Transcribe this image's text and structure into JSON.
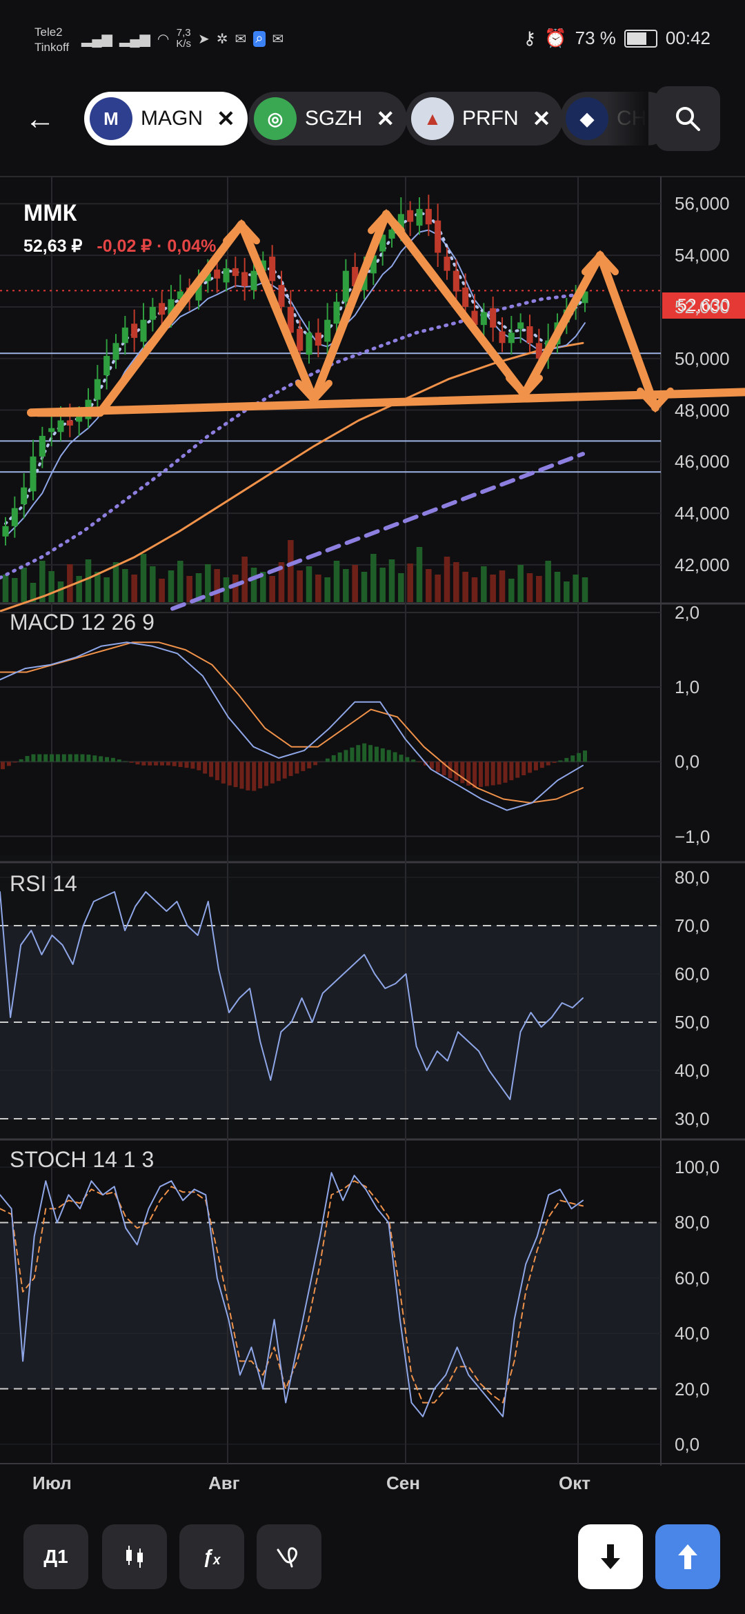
{
  "status": {
    "carrier1": "Tele2",
    "carrier2": "Tinkoff",
    "speed_top": "7,3",
    "speed_bottom": "K/s",
    "battery": "73 %",
    "time": "00:42"
  },
  "header": {
    "tabs": [
      {
        "label": "MAGN",
        "active": true
      },
      {
        "label": "SGZH",
        "active": false
      },
      {
        "label": "PRFN",
        "active": false
      },
      {
        "label": "CH",
        "active": false
      }
    ]
  },
  "instrument": {
    "name": "ММК",
    "price": "52,63 ₽",
    "change": "-0,02 ₽ · 0,04%",
    "last_price_tag": "52,630"
  },
  "panels": {
    "macd": "MACD 12 26 9",
    "rsi": "RSI 14",
    "stoch": "STOCH 14 1 3"
  },
  "toolbar": {
    "interval": "Д1"
  },
  "colors": {
    "bg": "#0f0f11",
    "up": "#2e9e3e",
    "down": "#c03a2b",
    "orange": "#f0924a",
    "blue": "#8fa7e8",
    "purple": "#8c7fe0",
    "accent_blue": "#4a86e8",
    "price_red": "#e53935"
  },
  "chart_data": [
    {
      "type": "candlestick",
      "title": "ММК",
      "x_ticks": [
        "Июл",
        "Авг",
        "Сен",
        "Окт"
      ],
      "y_ticks": [
        "56,000",
        "54,000",
        "52,000",
        "50,000",
        "48,000",
        "46,000",
        "44,000",
        "42,000"
      ],
      "ylim": [
        40.5,
        57
      ],
      "last_price": 52.63,
      "close": [
        43.5,
        44.2,
        45.0,
        46.2,
        47.0,
        47.3,
        47.6,
        47.4,
        47.8,
        48.4,
        49.2,
        50.1,
        50.6,
        51.2,
        50.8,
        51.5,
        52.0,
        51.7,
        52.3,
        52.6,
        52.4,
        53.0,
        53.3,
        53.1,
        53.5,
        53.2,
        52.8,
        53.4,
        53.8,
        53.0,
        52.0,
        51.0,
        50.3,
        51.0,
        50.5,
        51.5,
        52.2,
        53.4,
        52.8,
        53.3,
        54.0,
        54.8,
        55.0,
        55.6,
        55.3,
        55.8,
        55.2,
        54.1,
        53.4,
        52.6,
        52.0,
        51.3,
        51.8,
        51.2,
        50.6,
        51.0,
        51.4,
        50.6,
        50.0,
        50.7,
        51.4,
        51.9,
        52.3,
        52.6
      ],
      "series": [
        {
          "name": "SMA 200",
          "values": [
            40.3,
            40.6,
            40.9,
            41.2,
            41.5,
            41.8,
            42.1,
            42.4,
            42.7,
            43.0,
            43.3,
            43.6,
            43.9,
            44.2,
            44.5,
            44.8,
            45.1,
            45.4,
            45.7,
            46.0,
            46.3
          ]
        },
        {
          "name": "SMA 100",
          "values": [
            40.2,
            40.8,
            41.5,
            42.3,
            43.3,
            44.4,
            45.5,
            46.6,
            47.6,
            48.4,
            49.2,
            49.8,
            50.3,
            50.6
          ]
        },
        {
          "name": "SMA 50",
          "values": [
            41.5,
            42.3,
            43.3,
            44.5,
            45.7,
            47.0,
            48.1,
            49.0,
            49.8,
            50.4,
            51.0,
            51.4,
            51.9,
            52.3,
            52.5
          ]
        }
      ],
      "levels": [
        50.2,
        46.8,
        45.6
      ],
      "annotations": "orange zigzag W-pattern with support line near 48,000"
    },
    {
      "type": "line",
      "title": "MACD 12 26 9",
      "y_ticks": [
        "2,0",
        "1,0",
        "0,0",
        "−1,0"
      ],
      "ylim": [
        -1.0,
        2.0
      ],
      "series": [
        {
          "name": "MACD",
          "values": [
            1.1,
            1.25,
            1.3,
            1.4,
            1.55,
            1.6,
            1.55,
            1.45,
            1.15,
            0.6,
            0.2,
            0.05,
            0.15,
            0.45,
            0.8,
            0.8,
            0.3,
            -0.1,
            -0.3,
            -0.5,
            -0.65,
            -0.55,
            -0.25,
            -0.05
          ]
        },
        {
          "name": "Signal",
          "values": [
            1.2,
            1.2,
            1.3,
            1.4,
            1.5,
            1.6,
            1.6,
            1.5,
            1.3,
            0.9,
            0.45,
            0.2,
            0.2,
            0.45,
            0.7,
            0.6,
            0.2,
            -0.1,
            -0.35,
            -0.5,
            -0.55,
            -0.5,
            -0.35
          ]
        }
      ],
      "histogram": [
        -0.1,
        0.1,
        0.1,
        0.1,
        0.05,
        -0.05,
        -0.05,
        -0.1,
        -0.3,
        -0.4,
        -0.25,
        -0.1,
        0.1,
        0.25,
        0.15,
        0.0,
        -0.2,
        -0.35,
        -0.3,
        -0.15,
        0.0,
        0.15
      ]
    },
    {
      "type": "line",
      "title": "RSI 14",
      "y_ticks": [
        "80,0",
        "70,0",
        "60,0",
        "50,0",
        "40,0",
        "30,0"
      ],
      "ylim": [
        30,
        80
      ],
      "levels": [
        70,
        50,
        30
      ],
      "values": [
        77,
        51,
        66,
        69,
        64,
        68,
        66,
        62,
        70,
        75,
        76,
        77,
        69,
        74,
        77,
        75,
        73,
        75,
        70,
        68,
        75,
        61,
        52,
        55,
        57,
        46,
        38,
        48,
        50,
        55,
        50,
        56,
        58,
        60,
        62,
        64,
        60,
        57,
        58,
        60,
        45,
        40,
        44,
        42,
        48,
        46,
        44,
        40,
        37,
        34,
        48,
        52,
        49,
        51,
        54,
        53,
        55
      ]
    },
    {
      "type": "line",
      "title": "STOCH 14 1 3",
      "y_ticks": [
        "100,0",
        "80,0",
        "60,0",
        "40,0",
        "20,0",
        "0,0"
      ],
      "ylim": [
        0,
        100
      ],
      "levels": [
        80,
        20
      ],
      "series": [
        {
          "name": "%K",
          "values": [
            90,
            85,
            30,
            75,
            95,
            80,
            90,
            85,
            95,
            90,
            93,
            78,
            72,
            85,
            93,
            95,
            88,
            92,
            90,
            60,
            45,
            25,
            35,
            20,
            45,
            15,
            35,
            55,
            75,
            98,
            88,
            97,
            92,
            85,
            80,
            45,
            15,
            10,
            20,
            25,
            35,
            25,
            20,
            15,
            10,
            45,
            65,
            75,
            90,
            92,
            85,
            88
          ]
        },
        {
          "name": "%D",
          "values": [
            85,
            83,
            55,
            60,
            85,
            85,
            88,
            87,
            92,
            90,
            91,
            82,
            78,
            80,
            88,
            93,
            91,
            91,
            88,
            70,
            50,
            30,
            30,
            25,
            35,
            20,
            30,
            45,
            65,
            90,
            92,
            95,
            93,
            88,
            82,
            55,
            25,
            15,
            15,
            20,
            28,
            28,
            22,
            18,
            15,
            30,
            55,
            70,
            82,
            88,
            87,
            86
          ]
        }
      ]
    }
  ]
}
